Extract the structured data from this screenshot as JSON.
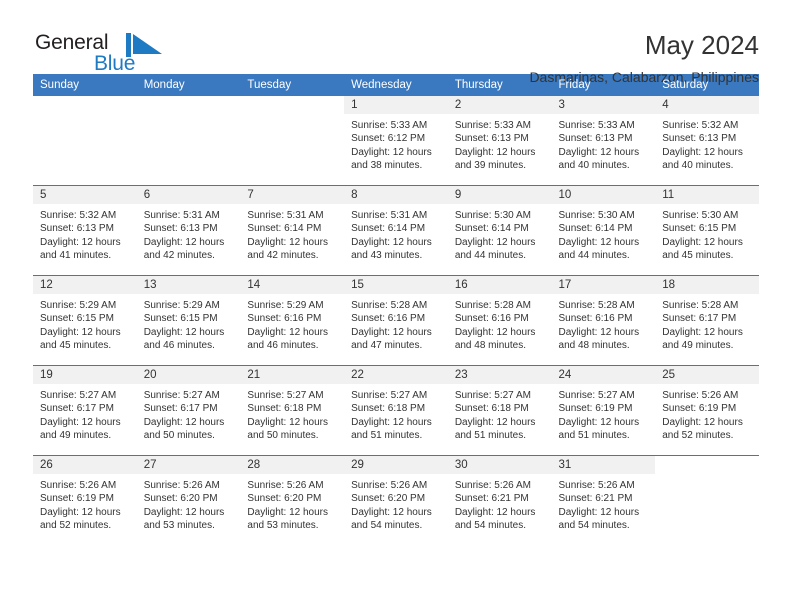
{
  "branding": {
    "name_part1": "General",
    "name_part2": "Blue",
    "mark_icon": "blue-triangle-flag-icon",
    "accent_color": "#1f7ac4"
  },
  "header": {
    "title": "May 2024",
    "subtitle": "Dasmarinas, Calabarzon, Philippines"
  },
  "calendar": {
    "header_background": "#3a78bf",
    "daynum_background": "#f1f1f1",
    "weekday_headers": [
      "Sunday",
      "Monday",
      "Tuesday",
      "Wednesday",
      "Thursday",
      "Friday",
      "Saturday"
    ],
    "weeks": [
      [
        {
          "day": "",
          "blank": true,
          "sunrise": "",
          "sunset": "",
          "daylight1": "",
          "daylight2": ""
        },
        {
          "day": "",
          "blank": true,
          "sunrise": "",
          "sunset": "",
          "daylight1": "",
          "daylight2": ""
        },
        {
          "day": "",
          "blank": true,
          "sunrise": "",
          "sunset": "",
          "daylight1": "",
          "daylight2": ""
        },
        {
          "day": "1",
          "sunrise": "Sunrise: 5:33 AM",
          "sunset": "Sunset: 6:12 PM",
          "daylight1": "Daylight: 12 hours",
          "daylight2": "and 38 minutes."
        },
        {
          "day": "2",
          "sunrise": "Sunrise: 5:33 AM",
          "sunset": "Sunset: 6:13 PM",
          "daylight1": "Daylight: 12 hours",
          "daylight2": "and 39 minutes."
        },
        {
          "day": "3",
          "sunrise": "Sunrise: 5:33 AM",
          "sunset": "Sunset: 6:13 PM",
          "daylight1": "Daylight: 12 hours",
          "daylight2": "and 40 minutes."
        },
        {
          "day": "4",
          "sunrise": "Sunrise: 5:32 AM",
          "sunset": "Sunset: 6:13 PM",
          "daylight1": "Daylight: 12 hours",
          "daylight2": "and 40 minutes."
        }
      ],
      [
        {
          "day": "5",
          "sunrise": "Sunrise: 5:32 AM",
          "sunset": "Sunset: 6:13 PM",
          "daylight1": "Daylight: 12 hours",
          "daylight2": "and 41 minutes."
        },
        {
          "day": "6",
          "sunrise": "Sunrise: 5:31 AM",
          "sunset": "Sunset: 6:13 PM",
          "daylight1": "Daylight: 12 hours",
          "daylight2": "and 42 minutes."
        },
        {
          "day": "7",
          "sunrise": "Sunrise: 5:31 AM",
          "sunset": "Sunset: 6:14 PM",
          "daylight1": "Daylight: 12 hours",
          "daylight2": "and 42 minutes."
        },
        {
          "day": "8",
          "sunrise": "Sunrise: 5:31 AM",
          "sunset": "Sunset: 6:14 PM",
          "daylight1": "Daylight: 12 hours",
          "daylight2": "and 43 minutes."
        },
        {
          "day": "9",
          "sunrise": "Sunrise: 5:30 AM",
          "sunset": "Sunset: 6:14 PM",
          "daylight1": "Daylight: 12 hours",
          "daylight2": "and 44 minutes."
        },
        {
          "day": "10",
          "sunrise": "Sunrise: 5:30 AM",
          "sunset": "Sunset: 6:14 PM",
          "daylight1": "Daylight: 12 hours",
          "daylight2": "and 44 minutes."
        },
        {
          "day": "11",
          "sunrise": "Sunrise: 5:30 AM",
          "sunset": "Sunset: 6:15 PM",
          "daylight1": "Daylight: 12 hours",
          "daylight2": "and 45 minutes."
        }
      ],
      [
        {
          "day": "12",
          "sunrise": "Sunrise: 5:29 AM",
          "sunset": "Sunset: 6:15 PM",
          "daylight1": "Daylight: 12 hours",
          "daylight2": "and 45 minutes."
        },
        {
          "day": "13",
          "sunrise": "Sunrise: 5:29 AM",
          "sunset": "Sunset: 6:15 PM",
          "daylight1": "Daylight: 12 hours",
          "daylight2": "and 46 minutes."
        },
        {
          "day": "14",
          "sunrise": "Sunrise: 5:29 AM",
          "sunset": "Sunset: 6:16 PM",
          "daylight1": "Daylight: 12 hours",
          "daylight2": "and 46 minutes."
        },
        {
          "day": "15",
          "sunrise": "Sunrise: 5:28 AM",
          "sunset": "Sunset: 6:16 PM",
          "daylight1": "Daylight: 12 hours",
          "daylight2": "and 47 minutes."
        },
        {
          "day": "16",
          "sunrise": "Sunrise: 5:28 AM",
          "sunset": "Sunset: 6:16 PM",
          "daylight1": "Daylight: 12 hours",
          "daylight2": "and 48 minutes."
        },
        {
          "day": "17",
          "sunrise": "Sunrise: 5:28 AM",
          "sunset": "Sunset: 6:16 PM",
          "daylight1": "Daylight: 12 hours",
          "daylight2": "and 48 minutes."
        },
        {
          "day": "18",
          "sunrise": "Sunrise: 5:28 AM",
          "sunset": "Sunset: 6:17 PM",
          "daylight1": "Daylight: 12 hours",
          "daylight2": "and 49 minutes."
        }
      ],
      [
        {
          "day": "19",
          "sunrise": "Sunrise: 5:27 AM",
          "sunset": "Sunset: 6:17 PM",
          "daylight1": "Daylight: 12 hours",
          "daylight2": "and 49 minutes."
        },
        {
          "day": "20",
          "sunrise": "Sunrise: 5:27 AM",
          "sunset": "Sunset: 6:17 PM",
          "daylight1": "Daylight: 12 hours",
          "daylight2": "and 50 minutes."
        },
        {
          "day": "21",
          "sunrise": "Sunrise: 5:27 AM",
          "sunset": "Sunset: 6:18 PM",
          "daylight1": "Daylight: 12 hours",
          "daylight2": "and 50 minutes."
        },
        {
          "day": "22",
          "sunrise": "Sunrise: 5:27 AM",
          "sunset": "Sunset: 6:18 PM",
          "daylight1": "Daylight: 12 hours",
          "daylight2": "and 51 minutes."
        },
        {
          "day": "23",
          "sunrise": "Sunrise: 5:27 AM",
          "sunset": "Sunset: 6:18 PM",
          "daylight1": "Daylight: 12 hours",
          "daylight2": "and 51 minutes."
        },
        {
          "day": "24",
          "sunrise": "Sunrise: 5:27 AM",
          "sunset": "Sunset: 6:19 PM",
          "daylight1": "Daylight: 12 hours",
          "daylight2": "and 51 minutes."
        },
        {
          "day": "25",
          "sunrise": "Sunrise: 5:26 AM",
          "sunset": "Sunset: 6:19 PM",
          "daylight1": "Daylight: 12 hours",
          "daylight2": "and 52 minutes."
        }
      ],
      [
        {
          "day": "26",
          "sunrise": "Sunrise: 5:26 AM",
          "sunset": "Sunset: 6:19 PM",
          "daylight1": "Daylight: 12 hours",
          "daylight2": "and 52 minutes."
        },
        {
          "day": "27",
          "sunrise": "Sunrise: 5:26 AM",
          "sunset": "Sunset: 6:20 PM",
          "daylight1": "Daylight: 12 hours",
          "daylight2": "and 53 minutes."
        },
        {
          "day": "28",
          "sunrise": "Sunrise: 5:26 AM",
          "sunset": "Sunset: 6:20 PM",
          "daylight1": "Daylight: 12 hours",
          "daylight2": "and 53 minutes."
        },
        {
          "day": "29",
          "sunrise": "Sunrise: 5:26 AM",
          "sunset": "Sunset: 6:20 PM",
          "daylight1": "Daylight: 12 hours",
          "daylight2": "and 54 minutes."
        },
        {
          "day": "30",
          "sunrise": "Sunrise: 5:26 AM",
          "sunset": "Sunset: 6:21 PM",
          "daylight1": "Daylight: 12 hours",
          "daylight2": "and 54 minutes."
        },
        {
          "day": "31",
          "sunrise": "Sunrise: 5:26 AM",
          "sunset": "Sunset: 6:21 PM",
          "daylight1": "Daylight: 12 hours",
          "daylight2": "and 54 minutes."
        },
        {
          "day": "",
          "blank": true,
          "sunrise": "",
          "sunset": "",
          "daylight1": "",
          "daylight2": ""
        }
      ]
    ]
  }
}
